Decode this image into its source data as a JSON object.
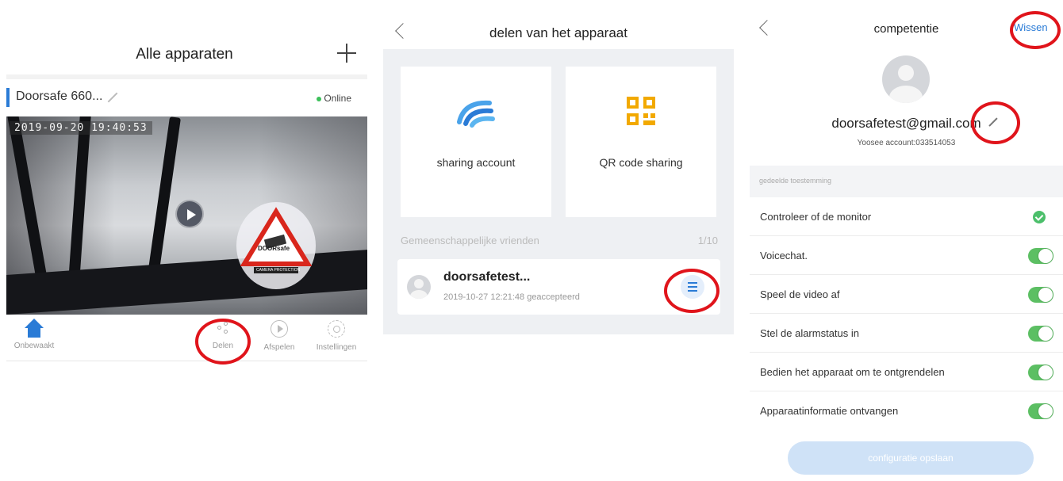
{
  "colors": {
    "accent": "#2a7bd6",
    "online": "#3cc05a",
    "toggle_on": "#5cbf63",
    "highlight_ring": "#e0141b",
    "save_button": "#cfe2f7"
  },
  "screen1": {
    "title": "Alle apparaten",
    "add_icon": "plus-icon",
    "device": {
      "name": "Doorsafe 660...",
      "status": "Online"
    },
    "video": {
      "timestamp": "2019-09-20  19:40:53",
      "sign_text": "DOORsafe",
      "sign_caption": "CAMERA PROTECTION"
    },
    "tabs": [
      {
        "label": "Onbewaakt",
        "icon": "home-icon"
      },
      {
        "label": "Delen",
        "icon": "share-icon"
      },
      {
        "label": "Afspelen",
        "icon": "play-circle-icon"
      },
      {
        "label": "Instellingen",
        "icon": "gear-icon"
      }
    ]
  },
  "screen2": {
    "title": "delen van het apparaat",
    "cards": [
      {
        "label": "sharing account",
        "icon": "share-account-icon"
      },
      {
        "label": "QR code sharing",
        "icon": "qr-code-icon"
      }
    ],
    "friends_header": "Gemeenschappelijke vrienden",
    "friends_count": "1/10",
    "friend": {
      "name": "doorsafetest...",
      "subtitle": "2019-10-27 12:21:48 geaccepteerd"
    }
  },
  "screen3": {
    "title": "competentie",
    "action": "Wissen",
    "email": "doorsafetest@gmail.com",
    "account": "Yoosee account:033514053",
    "permissions_header": "gedeelde toestemming",
    "permissions": [
      {
        "label": "Controleer of de monitor",
        "control": "check"
      },
      {
        "label": "Voicechat.",
        "control": "toggle-on"
      },
      {
        "label": "Speel de video af",
        "control": "toggle-on"
      },
      {
        "label": "Stel de alarmstatus in",
        "control": "toggle-on"
      },
      {
        "label": "Bedien het apparaat om te ontgrendelen",
        "control": "toggle-on"
      },
      {
        "label": "Apparaatinformatie ontvangen",
        "control": "toggle-on"
      }
    ],
    "save_label": "configuratie opslaan"
  }
}
